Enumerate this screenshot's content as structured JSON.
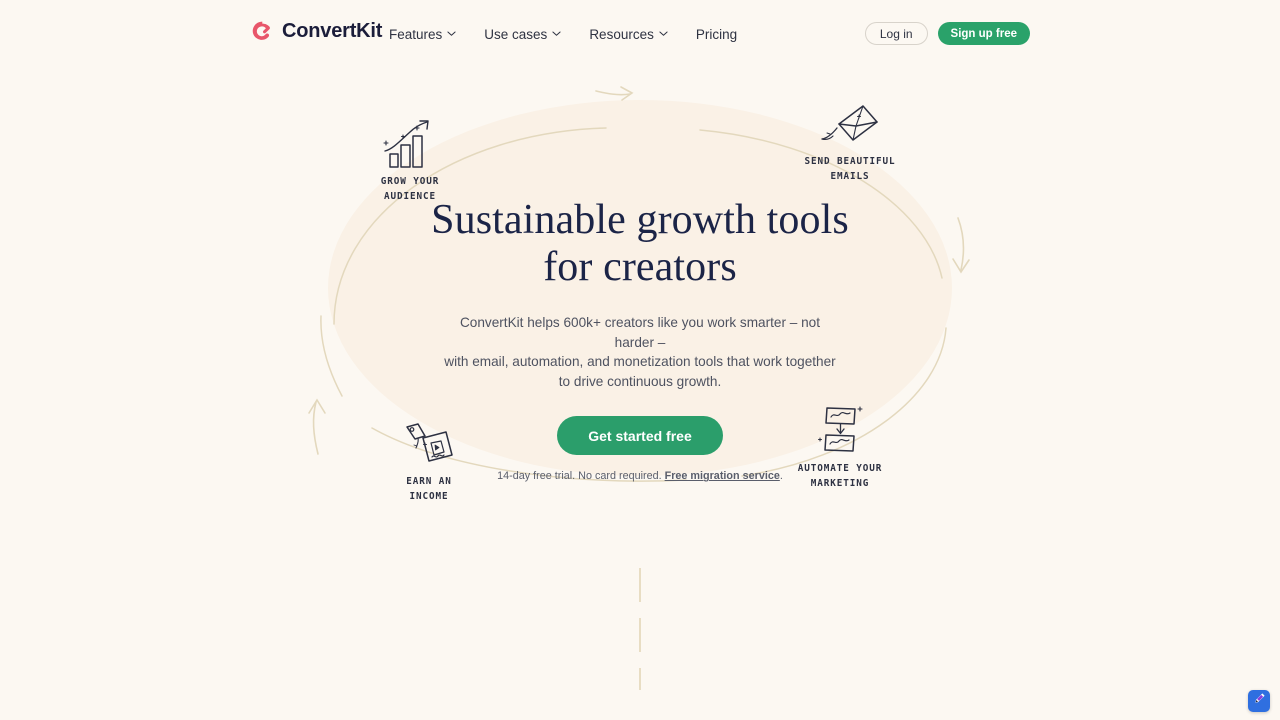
{
  "brand": {
    "name": "ConvertKit",
    "logo_icon": "convertkit-swirl-logo",
    "logo_color": "#e8566a"
  },
  "nav": {
    "items": [
      {
        "label": "Features",
        "has_dropdown": true,
        "icon": "chevron-down-icon"
      },
      {
        "label": "Use cases",
        "has_dropdown": true,
        "icon": "chevron-down-icon"
      },
      {
        "label": "Resources",
        "has_dropdown": true,
        "icon": "chevron-down-icon"
      },
      {
        "label": "Pricing",
        "has_dropdown": false,
        "icon": ""
      }
    ],
    "login_label": "Log in",
    "signup_label": "Sign up free",
    "signup_color": "#2aa26a"
  },
  "hero": {
    "headline_line1": "Sustainable growth tools",
    "headline_line2": "for creators",
    "headline_color": "#1b2447",
    "subhead_line1": "ConvertKit helps 600k+ creators like you work smarter – not harder –",
    "subhead_line2": "with email, automation, and monetization tools that work together",
    "subhead_line3": "to drive continuous growth.",
    "cta_label": "Get started free",
    "cta_color": "#2b9e6b",
    "trial_note_before": "14-day free trial. No card required. ",
    "trial_note_link": "Free migration service",
    "trial_note_after": ".",
    "ellipse_color": "#faf1e6",
    "background_color": "#fcf8f2",
    "arc_color": "#e3d8bd"
  },
  "callouts": [
    {
      "id": "grow",
      "icon": "bar-chart-growth-icon",
      "caption_line1": "GROW YOUR",
      "caption_line2": "AUDIENCE"
    },
    {
      "id": "email",
      "icon": "flying-envelope-icon",
      "caption_line1": "SEND BEAUTIFUL",
      "caption_line2": "EMAILS"
    },
    {
      "id": "income",
      "icon": "price-tag-video-icon",
      "caption_line1": "EARN AN",
      "caption_line2": "INCOME"
    },
    {
      "id": "automate",
      "icon": "automation-flow-icon",
      "caption_line1": "AUTOMATE YOUR",
      "caption_line2": "MARKETING"
    }
  ],
  "widget": {
    "icon": "pen-editor-icon",
    "color": "#2f6fe0"
  }
}
